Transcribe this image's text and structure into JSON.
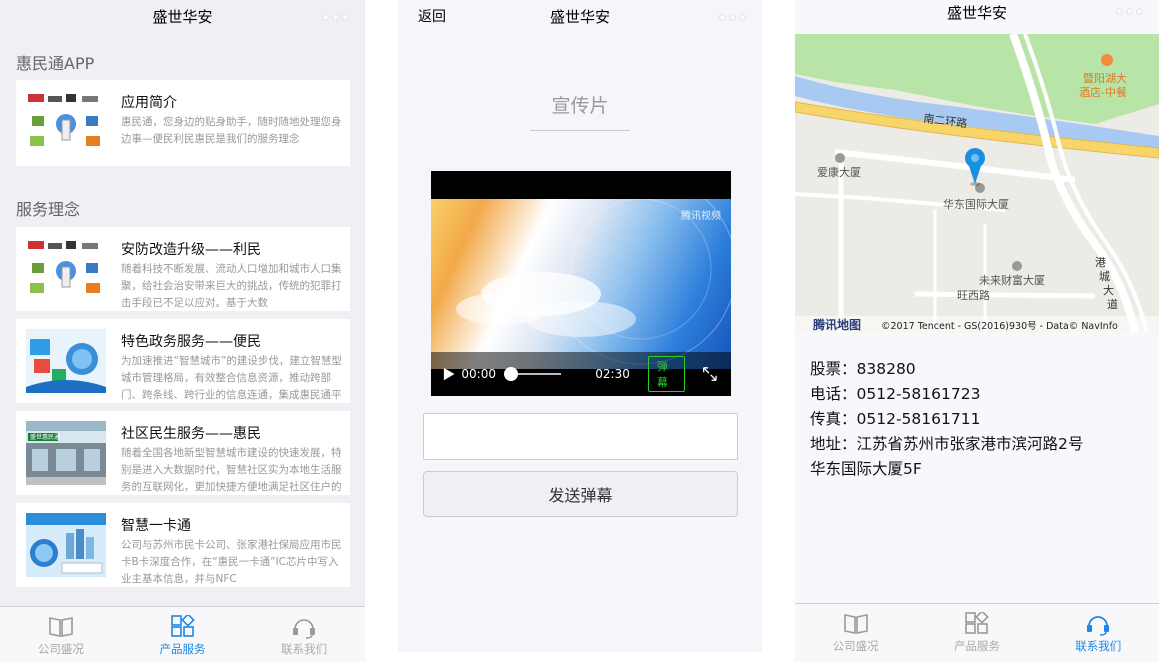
{
  "screen1": {
    "nav_title": "盛世华安",
    "section1": "惠民通APP",
    "intro": {
      "title": "应用简介",
      "desc": "惠民通，您身边的贴身助手，随时随地处理您身边事—便民利民惠民是我们的服务理念"
    },
    "section2": "服务理念",
    "items": [
      {
        "title": "安防改造升级——利民",
        "desc": "随着科技不断发展、流动人口增加和城市人口集聚，给社会治安带来巨大的挑战，传统的犯罪打击手段已不足以应对。基于大数"
      },
      {
        "title": "特色政务服务——便民",
        "desc": "为加速推进“智慧城市”的建设步伐，建立智慧型城市管理格局，有效整合信息资源，推动跨部门、跨条线、跨行业的信息连通，集成惠民通平"
      },
      {
        "title": "社区民生服务——惠民",
        "desc": "随着全国各地新型智慧城市建设的快速发展，特别是进入大数据时代，智慧社区实为本地生活服务的互联网化，更加快捷方便地满足社区住户的"
      },
      {
        "title": "智慧一卡通",
        "desc": "公司与苏州市民卡公司、张家港社保局应用市民卡B卡深度合作，在“惠民一卡通”IC芯片中写入业主基本信息，并与NFC"
      }
    ],
    "thumb_text": "盛世惠民通",
    "tabs": [
      "公司盛况",
      "产品服务",
      "联系我们"
    ],
    "active_tab": 1
  },
  "screen2": {
    "back": "返回",
    "nav_title": "盛世华安",
    "video_title": "宣传片",
    "video_logo": "腾讯视频",
    "current_time": "00:00",
    "duration": "02:30",
    "danmu_label": "弹幕",
    "progress": 0,
    "input_value": "",
    "send_label": "发送弹幕"
  },
  "screen3": {
    "nav_title": "盛世华安",
    "map_labels": {
      "poi_restaurant": "暨阳湖大",
      "poi_restaurant2": "酒店-中餐",
      "road1": "南二环路",
      "aikang": "爱康大厦",
      "huadong": "华东国际大厦",
      "weilai": "未来财富大厦",
      "wangxi": "旺西路",
      "gangcheng1": "港",
      "gangcheng2": "城",
      "gangcheng3": "大",
      "gangcheng4": "道",
      "brand": "腾讯地图",
      "copyright": "©2017 Tencent - GS(2016)930号 - Data© NavInfo"
    },
    "info": {
      "stock": "股票：838280",
      "phone": "电话：0512-58161723",
      "fax": "传真：0512-58161711",
      "address1": "地址：江苏省苏州市张家港市滨河路2号",
      "address2": "华东国际大厦5F"
    },
    "tabs": [
      "公司盛况",
      "产品服务",
      "联系我们"
    ],
    "active_tab": 2
  },
  "colors": {
    "accent": "#1c88e6",
    "danmu_green": "#26d126",
    "map_pin": "#1a8fe0"
  }
}
